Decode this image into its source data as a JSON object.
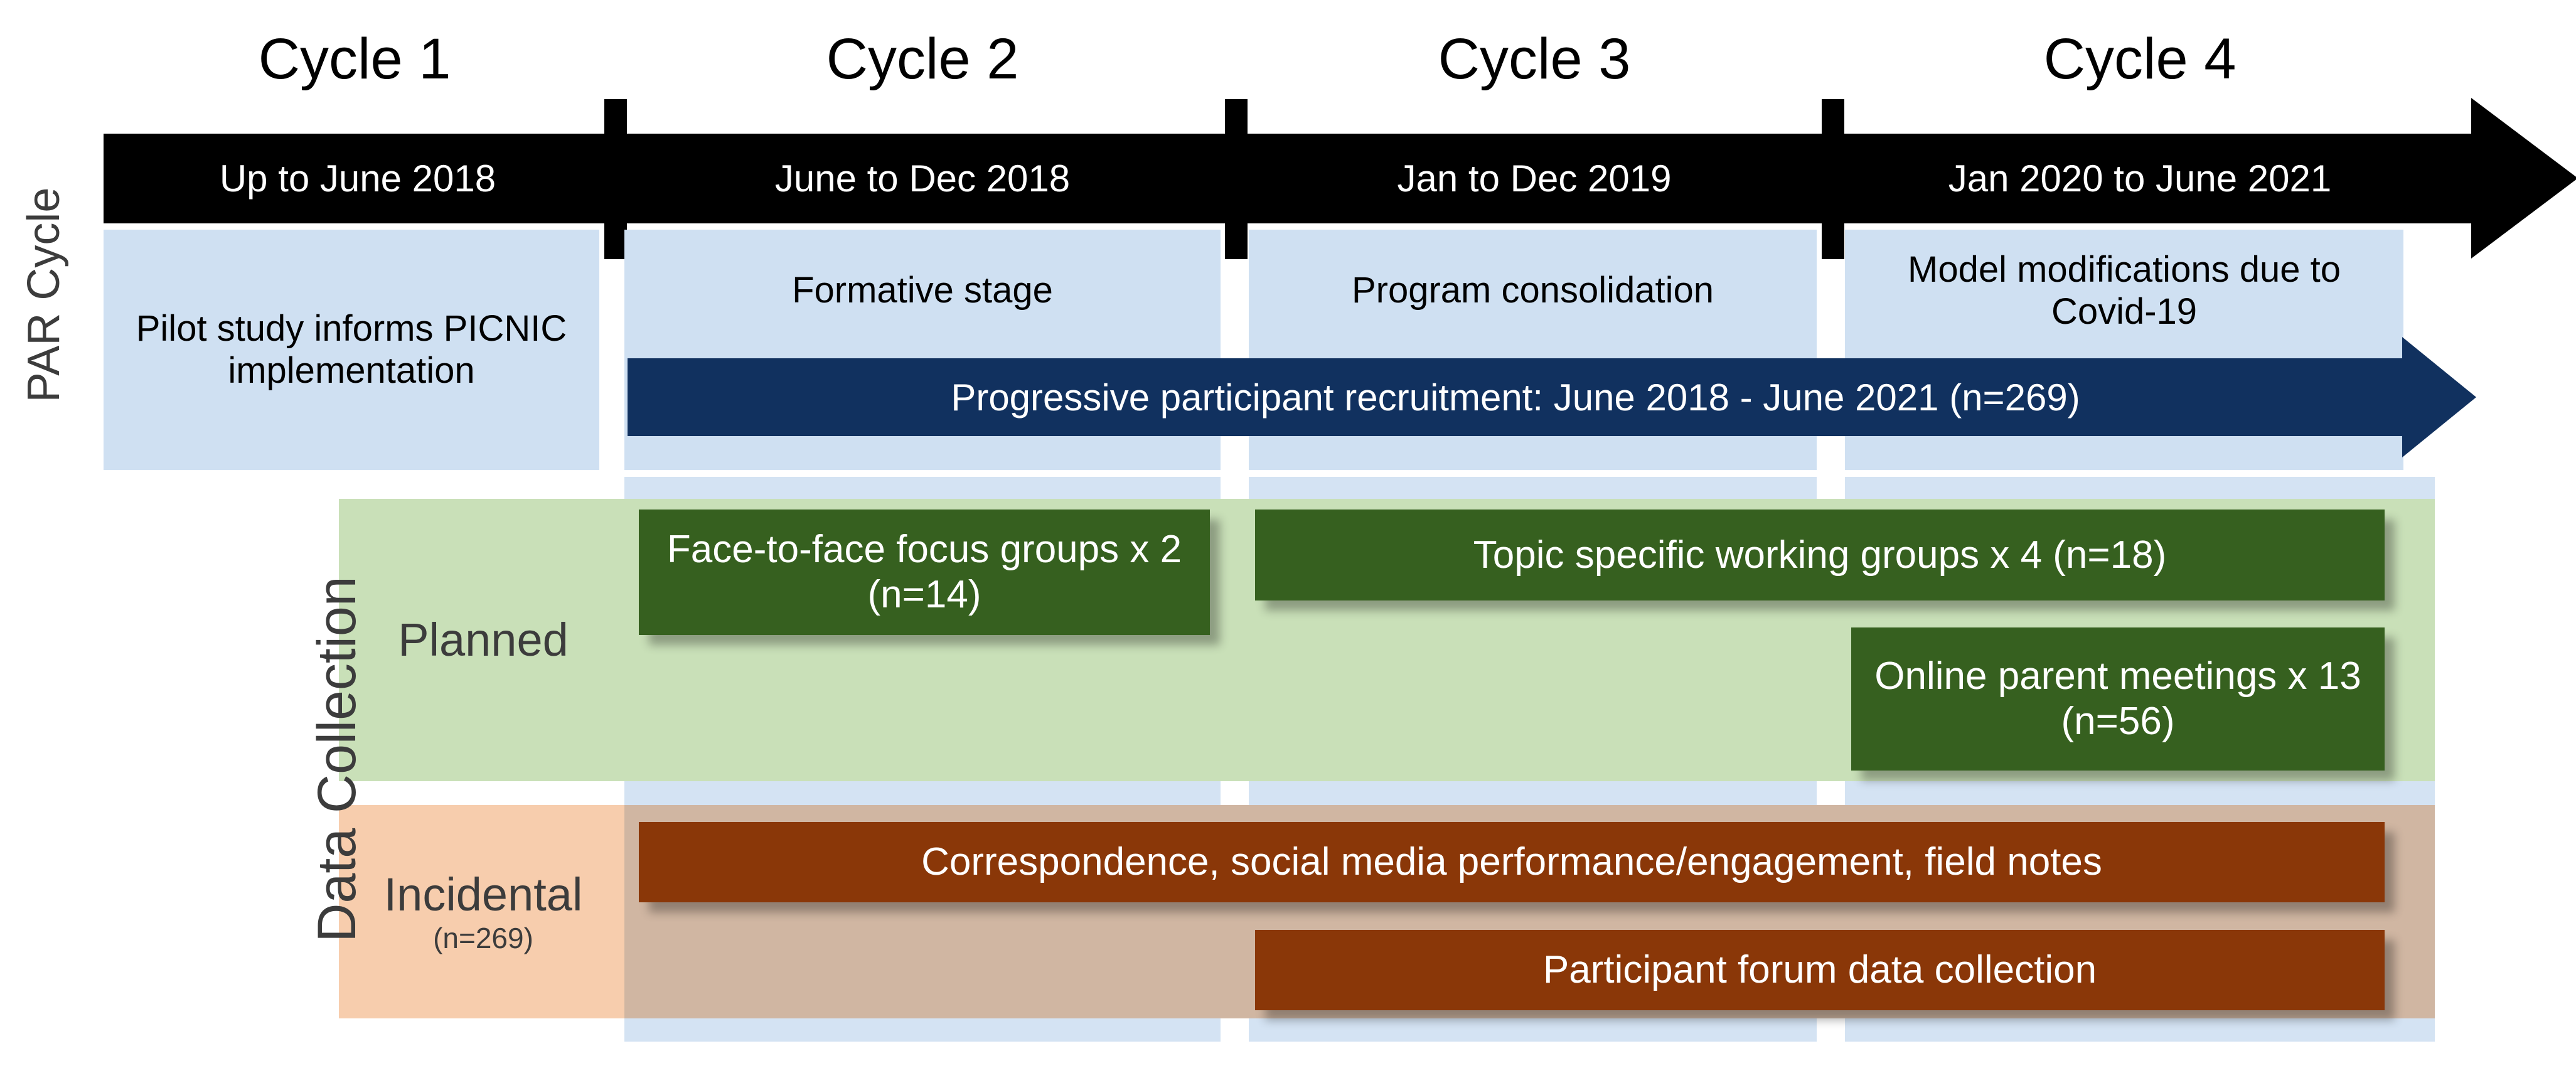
{
  "figure": {
    "type": "timeline-diagram",
    "side_labels": {
      "par_cycle": "PAR Cycle",
      "data_collection": "Data Collection"
    },
    "colors": {
      "timeline_arrow": "#000000",
      "par_box": "#cfe0f2",
      "recruitment_arrow": "#11315f",
      "planned_row": "#c9e0b8",
      "incidental_row": "#f7cdad",
      "planned_chip": "#36601f",
      "incidental_chip": "#8a3708",
      "column_band": "#cfe0f2"
    }
  },
  "cycles": [
    {
      "title": "Cycle 1",
      "dates": "Up to June 2018",
      "stage": "Pilot study informs PICNIC implementation"
    },
    {
      "title": "Cycle 2",
      "dates": "June to Dec 2018",
      "stage": "Formative stage"
    },
    {
      "title": "Cycle 3",
      "dates": "Jan to Dec 2019",
      "stage": "Program consolidation"
    },
    {
      "title": "Cycle 4",
      "dates": "Jan 2020 to June 2021",
      "stage": "Model modifications due to Covid-19"
    }
  ],
  "recruitment": {
    "label": "Progressive participant recruitment: June 2018 - June 2021 (n=269)"
  },
  "data_collection": {
    "planned": {
      "row_label": "Planned",
      "items": [
        {
          "label": "Face-to-face focus groups x 2 (n=14)"
        },
        {
          "label": "Topic specific working groups x 4 (n=18)"
        },
        {
          "label": "Online parent meetings x 13 (n=56)"
        }
      ]
    },
    "incidental": {
      "row_label": "Incidental",
      "row_sublabel": "(n=269)",
      "items": [
        {
          "label": "Correspondence, social media performance/engagement, field notes"
        },
        {
          "label": "Participant forum data collection"
        }
      ]
    }
  },
  "chart_data": {
    "type": "table",
    "title": "PAR Cycle and Data Collection timeline",
    "categories": [
      "Cycle 1",
      "Cycle 2",
      "Cycle 3",
      "Cycle 4"
    ],
    "series": [
      {
        "name": "Dates",
        "values": [
          "Up to June 2018",
          "June to Dec 2018",
          "Jan to Dec 2019",
          "Jan 2020 to June 2021"
        ]
      },
      {
        "name": "Stage",
        "values": [
          "Pilot study informs PICNIC implementation",
          "Formative stage",
          "Program consolidation",
          "Model modifications due to Covid-19"
        ]
      }
    ],
    "spans": [
      {
        "label": "Progressive participant recruitment: June 2018 - June 2021 (n=269)",
        "from": "Cycle 2",
        "to": "Cycle 4",
        "n": 269
      },
      {
        "label": "Face-to-face focus groups x 2 (n=14)",
        "from": "Cycle 2",
        "to": "Cycle 2",
        "n": 14,
        "count": 2,
        "category": "Planned"
      },
      {
        "label": "Topic specific working groups x 4 (n=18)",
        "from": "Cycle 3",
        "to": "Cycle 4",
        "n": 18,
        "count": 4,
        "category": "Planned"
      },
      {
        "label": "Online parent meetings x 13 (n=56)",
        "from": "Cycle 4",
        "to": "Cycle 4",
        "n": 56,
        "count": 13,
        "category": "Planned"
      },
      {
        "label": "Correspondence, social media performance/engagement, field notes",
        "from": "Cycle 2",
        "to": "Cycle 4",
        "category": "Incidental"
      },
      {
        "label": "Participant forum data collection",
        "from": "Cycle 3",
        "to": "Cycle 4",
        "category": "Incidental"
      }
    ]
  }
}
